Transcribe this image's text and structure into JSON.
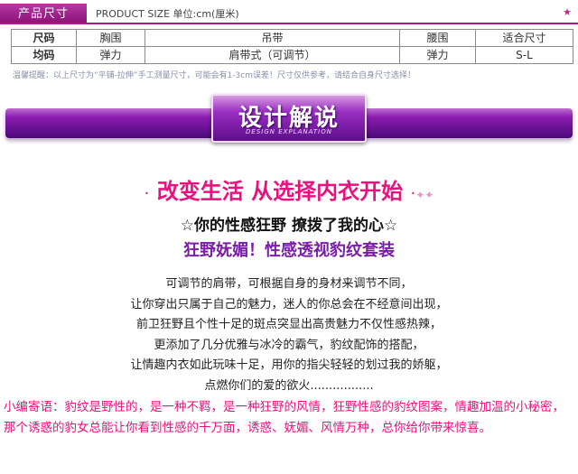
{
  "size_section": {
    "tab_label": "产品尺寸",
    "subtitle": "PRODUCT SIZE 单位:cm(厘米)",
    "corner_star": "★",
    "table": {
      "headers": [
        "尺码",
        "胸围",
        "吊带",
        "腰围",
        "适合尺寸"
      ],
      "row": [
        "均码",
        "弹力",
        "肩带式（可调节）",
        "弹力",
        "S-L"
      ]
    },
    "note": "温馨提醒：以上尺寸为“平铺-拉伸”手工测量尺寸，可能会有1-3cm误差！尺寸仅供参考，请结合自身尺寸选择！"
  },
  "design_banner": {
    "title": "设计解说",
    "subtitle_en": "DESIGN EXPLANATION",
    "colors": {
      "bar_top": "#c070d0",
      "bar_bottom": "#4b0a7a"
    }
  },
  "headline": {
    "text": "改变生活 从选择内衣开始",
    "left_mark": "·",
    "right_mark": "·",
    "stars": "✦✦",
    "color": "#e8127e"
  },
  "subtitle1": "☆你的性感狂野 撩拨了我的心☆",
  "subtitle2": "狂野妩媚！性感透视豹纹套装",
  "body_lines": [
    "可调节的肩带，可根据自身的身材来调节不同，",
    "让你穿出只属于自己的魅力，迷人的你总会在不经意间出现，",
    "前卫狂野且个性十足的斑点突显出高贵魅力不仅性感热辣，",
    "更添加了几分优雅与冰冷的霸气，豹纹配饰的搭配，",
    "让情趣内衣如此玩味十足，用你的指尖轻轻的划过我的娇躯，",
    "点燃你们的爱的欲火................."
  ],
  "editor_note": "小编寄语：豹纹是野性的，是一种不羁，是一种狂野的风情，狂野性感的豹纹图案，情趣加温的小秘密，那个诱惑的豹女总能让你看到性感的千万面，诱惑、妩媚、风情万种，总你给你带来惊喜。"
}
